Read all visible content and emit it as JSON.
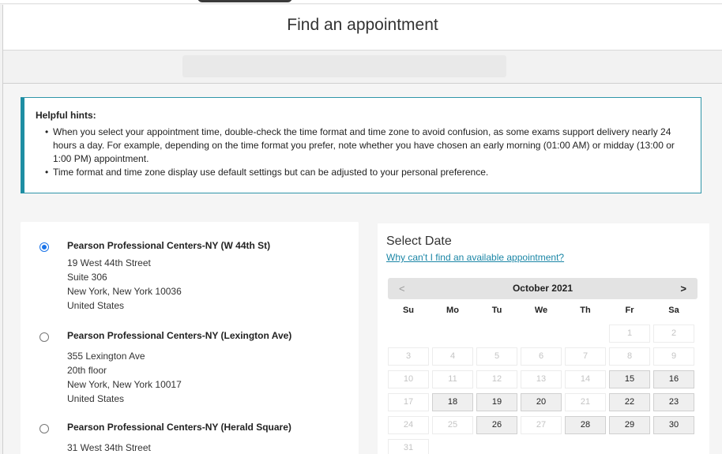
{
  "header": {
    "title": "Find an appointment"
  },
  "hints": {
    "title": "Helpful hints:",
    "items": [
      "When you select your appointment time, double-check the time format and time zone to avoid confusion, as some exams support delivery nearly 24 hours a day. For example, depending on the time format you prefer, note whether you have chosen an early morning (01:00 AM) or midday (13:00 or 1:00 PM) appointment.",
      "Time format and time zone display use default settings but can be adjusted to your personal preference."
    ]
  },
  "locations": [
    {
      "name": "Pearson Professional Centers-NY (W 44th St)",
      "selected": true,
      "address": [
        "19 West 44th Street",
        "Suite 306",
        "New York, New York 10036",
        "United States"
      ]
    },
    {
      "name": "Pearson Professional Centers-NY (Lexington Ave)",
      "selected": false,
      "address": [
        "355 Lexington Ave",
        "20th floor",
        "New York, New York 10017",
        "United States"
      ]
    },
    {
      "name": "Pearson Professional Centers-NY (Herald Square)",
      "selected": false,
      "address": [
        "31 West 34th Street"
      ]
    }
  ],
  "calendar": {
    "title": "Select Date",
    "help_link": "Why can't I find an available appointment?",
    "month_label": "October 2021",
    "prev": "<",
    "next": ">",
    "weekdays": [
      "Su",
      "Mo",
      "Tu",
      "We",
      "Th",
      "Fr",
      "Sa"
    ],
    "first_weekday": 5,
    "days_in_month": 31,
    "available_days": [
      15,
      16,
      18,
      19,
      20,
      22,
      23,
      26,
      28,
      29,
      30
    ]
  }
}
